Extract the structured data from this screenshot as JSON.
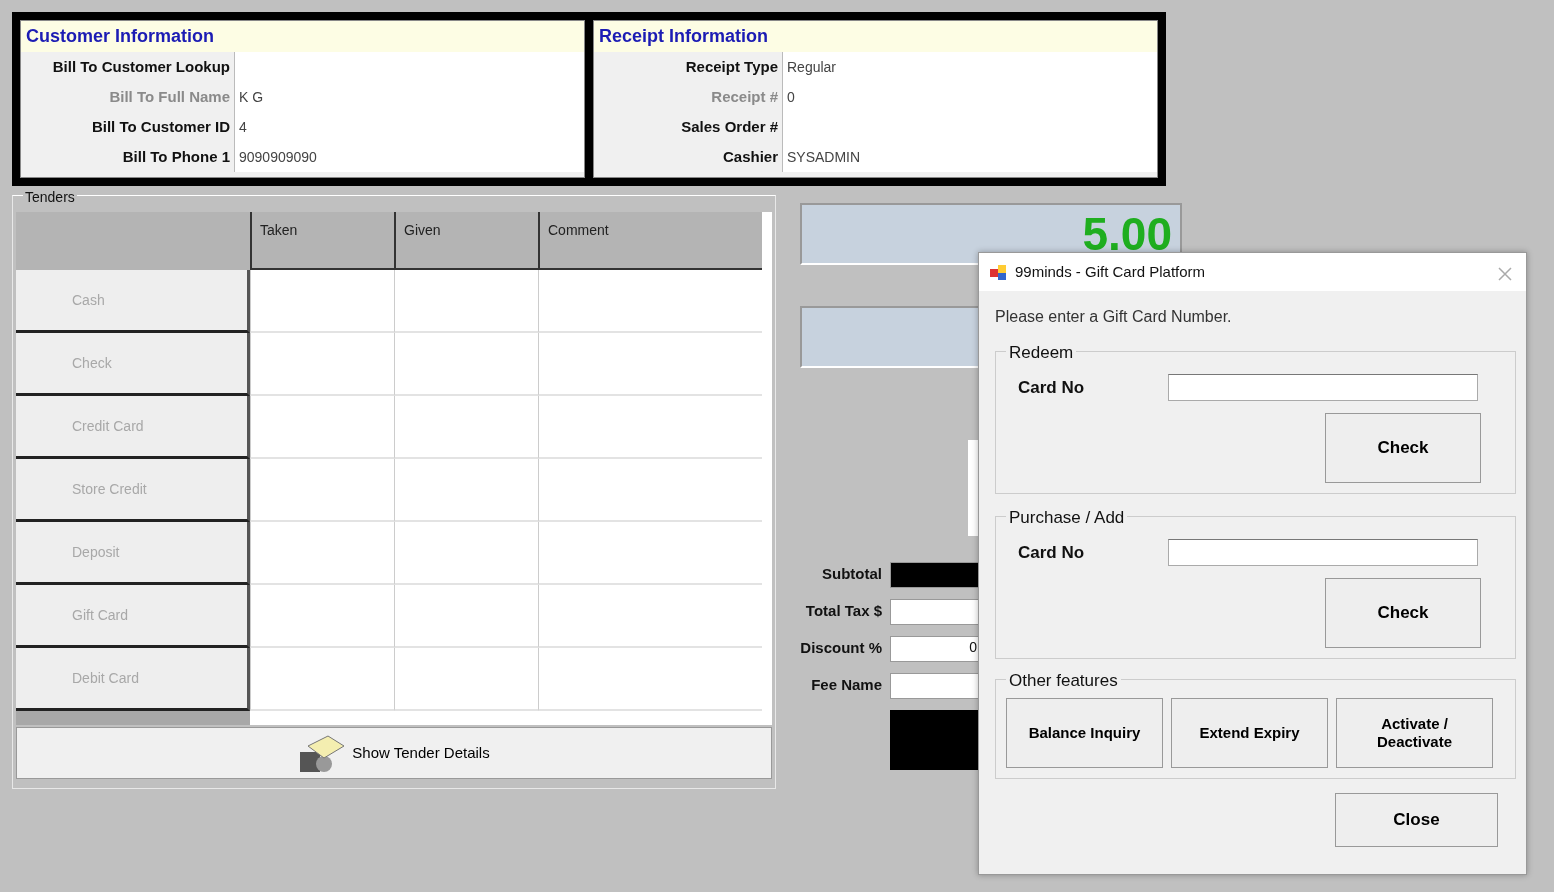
{
  "customer_info": {
    "title": "Customer Information",
    "rows": [
      {
        "label": "Bill To Customer Lookup",
        "disabled": false
      },
      {
        "label": "Bill To Full Name",
        "value": "K G",
        "disabled": true
      },
      {
        "label": "Bill To Customer ID",
        "value": "4",
        "disabled": false
      },
      {
        "label": "Bill To Phone 1",
        "value": "9090909090",
        "disabled": false
      }
    ]
  },
  "receipt_info": {
    "title": "Receipt Information",
    "rows": [
      {
        "label": "Receipt Type",
        "value": "Regular",
        "disabled": false
      },
      {
        "label": "Receipt #",
        "value": "0",
        "disabled": true
      },
      {
        "label": "Sales Order #",
        "disabled": false
      },
      {
        "label": "Cashier",
        "value": "SYSADMIN",
        "disabled": false
      }
    ]
  },
  "tenders": {
    "title": "Tenders",
    "columns": [
      "Taken",
      "Given",
      "Comment"
    ],
    "rows": [
      {
        "label": "Cash",
        "disabled": true
      },
      {
        "label": "Check",
        "disabled": true
      },
      {
        "label": "Credit Card",
        "disabled": true
      },
      {
        "label": "Store Credit",
        "disabled": true
      },
      {
        "label": "Deposit",
        "disabled": true
      },
      {
        "label": "Gift Card",
        "disabled": true
      },
      {
        "label": "Debit Card",
        "disabled": true
      }
    ],
    "details_button": "Show Tender Details"
  },
  "totals": {
    "amount": "5.00",
    "fields": [
      {
        "label": "Subtotal",
        "kind": "dark"
      },
      {
        "label": "Total Tax $",
        "kind": "input"
      },
      {
        "label": "Discount %",
        "kind": "input",
        "value": "0"
      },
      {
        "label": "Fee Name",
        "kind": "input"
      }
    ]
  },
  "dialog": {
    "title": "99minds - Gift Card Platform",
    "prompt": "Please enter a Gift Card Number.",
    "groups": [
      {
        "title": "Redeem",
        "field_label": "Card No",
        "button": "Check"
      },
      {
        "title": "Purchase / Add",
        "field_label": "Card No",
        "button": "Check"
      }
    ],
    "other_features": {
      "title": "Other features",
      "buttons": [
        "Balance Inquiry",
        "Extend Expiry",
        "Activate / Deactivate"
      ]
    },
    "close_button": "Close"
  }
}
